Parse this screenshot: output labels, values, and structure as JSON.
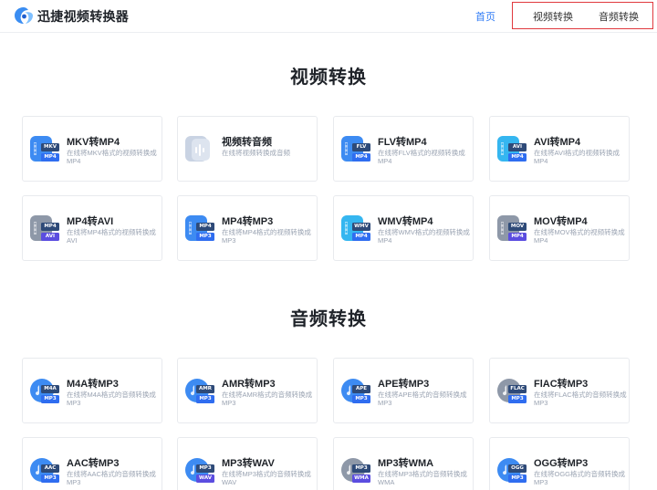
{
  "header": {
    "brand": "迅捷视频转换器",
    "nav": {
      "home": "首页",
      "video": "视频转换",
      "audio": "音频转换"
    }
  },
  "video_section": {
    "title": "视频转换",
    "cards": [
      {
        "title": "MKV转MP4",
        "desc": "在线将MKV格式的视频转换成MP4",
        "tag1": "MKV",
        "tag2": "MP4"
      },
      {
        "title": "视频转音频",
        "desc": "在线将视频转换成音频",
        "tag1": "",
        "tag2": ""
      },
      {
        "title": "FLV转MP4",
        "desc": "在线将FLV格式的视频转换成MP4",
        "tag1": "FLV",
        "tag2": "MP4"
      },
      {
        "title": "AVI转MP4",
        "desc": "在线将AVI格式的视频转换成MP4",
        "tag1": "AVI",
        "tag2": "MP4"
      },
      {
        "title": "MP4转AVI",
        "desc": "在线将MP4格式的视频转换成AVI",
        "tag1": "MP4",
        "tag2": "AVI"
      },
      {
        "title": "MP4转MP3",
        "desc": "在线将MP4格式的视频转换成MP3",
        "tag1": "MP4",
        "tag2": "MP3"
      },
      {
        "title": "WMV转MP4",
        "desc": "在线将WMV格式的视频转换成MP4",
        "tag1": "WMV",
        "tag2": "MP4"
      },
      {
        "title": "MOV转MP4",
        "desc": "在线将MOV格式的视频转换成MP4",
        "tag1": "MOV",
        "tag2": "MP4"
      }
    ]
  },
  "audio_section": {
    "title": "音频转换",
    "cards": [
      {
        "title": "M4A转MP3",
        "desc": "在线将M4A格式的音频转换成MP3",
        "tag1": "M4A",
        "tag2": "MP3"
      },
      {
        "title": "AMR转MP3",
        "desc": "在线将AMR格式的音频转换成MP3",
        "tag1": "AMR",
        "tag2": "MP3"
      },
      {
        "title": "APE转MP3",
        "desc": "在线将APE格式的音频转换成MP3",
        "tag1": "APE",
        "tag2": "MP3"
      },
      {
        "title": "FlAC转MP3",
        "desc": "在线将FLAC格式的音频转换成MP3",
        "tag1": "FLAC",
        "tag2": "MP3"
      },
      {
        "title": "AAC转MP3",
        "desc": "在线将AAC格式的音频转换成MP3",
        "tag1": "AAC",
        "tag2": "MP3"
      },
      {
        "title": "MP3转WAV",
        "desc": "在线将MP3格式的音频转换成WAV",
        "tag1": "MP3",
        "tag2": "WAV"
      },
      {
        "title": "MP3转WMA",
        "desc": "在线将MP3格式的音频转换成WMA",
        "tag1": "MP3",
        "tag2": "WMA"
      },
      {
        "title": "OGG转MP3",
        "desc": "在线将OGG格式的音频转换成MP3",
        "tag1": "OGG",
        "tag2": "MP3"
      }
    ]
  },
  "colors": {
    "accent": "#2f7bf5",
    "highlight_border": "#e0393e",
    "icon_blue": "#3d8bf2",
    "icon_cyan": "#35b6f0",
    "icon_grey": "#8e98a8"
  },
  "icons": {
    "logo": "app-logo-icon",
    "video": "film-strip-icon",
    "audio": "music-note-icon",
    "disc": "disc-icon",
    "waveform": "waveform-icon"
  }
}
